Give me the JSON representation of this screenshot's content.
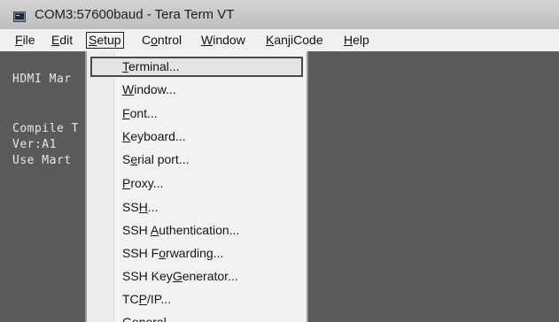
{
  "window": {
    "title": "COM3:57600baud - Tera Term VT",
    "icon": "terminal-icon"
  },
  "menu_bar": [
    {
      "pre": "",
      "key": "F",
      "post": "ile"
    },
    {
      "pre": "",
      "key": "E",
      "post": "dit"
    },
    {
      "pre": "",
      "key": "S",
      "post": "etup"
    },
    {
      "pre": "C",
      "key": "o",
      "post": "ntrol"
    },
    {
      "pre": "",
      "key": "W",
      "post": "indow"
    },
    {
      "pre": "",
      "key": "K",
      "post": "anjiCode"
    },
    {
      "pre": "",
      "key": "H",
      "post": "elp"
    }
  ],
  "terminal_lines": [
    "HDMI Mar",
    "Compile T",
    "Ver:A1",
    "Use Mart"
  ],
  "setup_menu": [
    {
      "pre": "",
      "key": "T",
      "post": "erminal..."
    },
    {
      "pre": "",
      "key": "W",
      "post": "indow..."
    },
    {
      "pre": "",
      "key": "F",
      "post": "ont..."
    },
    {
      "pre": "",
      "key": "K",
      "post": "eyboard..."
    },
    {
      "pre": "S",
      "key": "e",
      "post": "rial port..."
    },
    {
      "pre": "",
      "key": "P",
      "post": "roxy..."
    },
    {
      "pre": "SS",
      "key": "H",
      "post": "..."
    },
    {
      "pre": "SSH ",
      "key": "A",
      "post": "uthentication..."
    },
    {
      "pre": "SSH F",
      "key": "o",
      "post": "rwarding..."
    },
    {
      "pre": "SSH Key",
      "key": "G",
      "post": "enerator..."
    },
    {
      "pre": "TC",
      "key": "P",
      "post": "/IP..."
    },
    {
      "pre": "",
      "key": "G",
      "post": "eneral..."
    }
  ]
}
